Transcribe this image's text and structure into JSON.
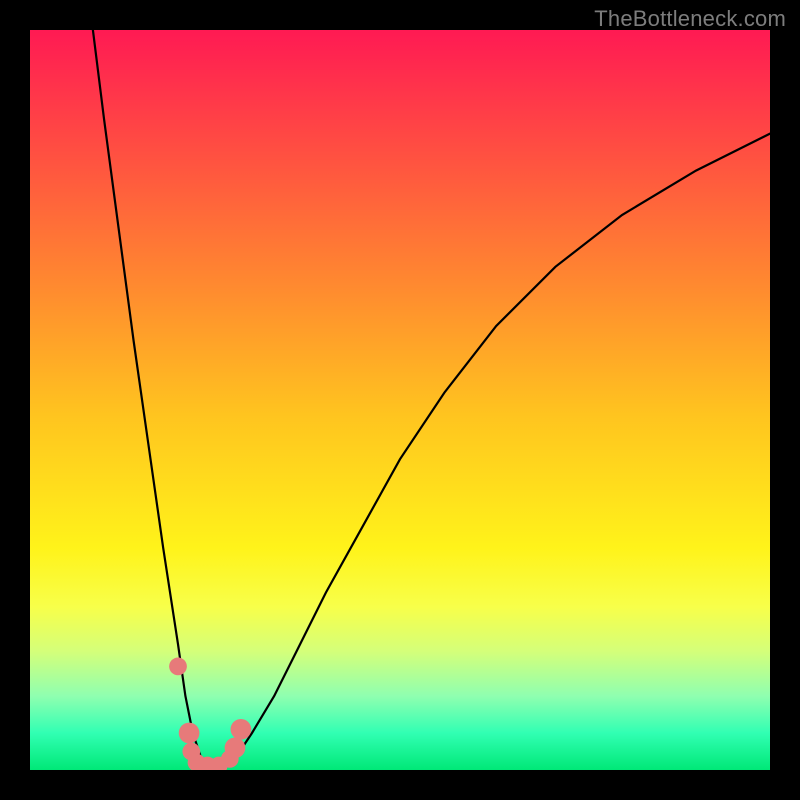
{
  "watermark": "TheBottleneck.com",
  "chart_data": {
    "type": "line",
    "title": "",
    "xlabel": "",
    "ylabel": "",
    "xlim": [
      0,
      100
    ],
    "ylim": [
      0,
      100
    ],
    "series": [
      {
        "name": "bottleneck-curve",
        "x": [
          8.5,
          10,
          12,
          14,
          16,
          18,
          20,
          21,
          22,
          23,
          24,
          26,
          28,
          30,
          33,
          36,
          40,
          45,
          50,
          56,
          63,
          71,
          80,
          90,
          100
        ],
        "y": [
          100,
          88,
          73,
          58,
          44,
          30,
          17,
          10,
          5,
          2,
          0.5,
          0.5,
          2,
          5,
          10,
          16,
          24,
          33,
          42,
          51,
          60,
          68,
          75,
          81,
          86
        ]
      }
    ],
    "markers": [
      {
        "x": 20.0,
        "y": 14.0,
        "r": 1.2
      },
      {
        "x": 21.5,
        "y": 5.0,
        "r": 1.4
      },
      {
        "x": 21.8,
        "y": 2.5,
        "r": 1.2
      },
      {
        "x": 22.5,
        "y": 1.0,
        "r": 1.2
      },
      {
        "x": 24.0,
        "y": 0.6,
        "r": 1.2
      },
      {
        "x": 25.5,
        "y": 0.6,
        "r": 1.2
      },
      {
        "x": 27.0,
        "y": 1.5,
        "r": 1.2
      },
      {
        "x": 27.7,
        "y": 3.0,
        "r": 1.4
      },
      {
        "x": 28.5,
        "y": 5.5,
        "r": 1.4
      }
    ],
    "marker_color": "#e77a7a",
    "curve_color": "#000000"
  }
}
